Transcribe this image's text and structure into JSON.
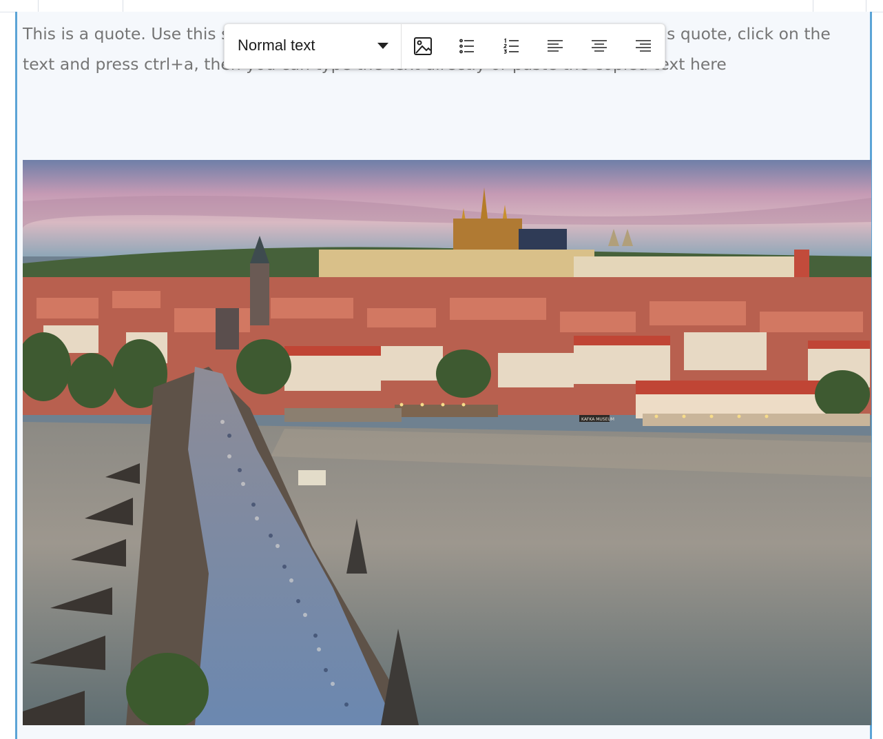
{
  "editor": {
    "quote_text": "This is a quote. Use this space to quote text from external resources. To edit this quote, click on the text and press ctrl+a, then you can type the text directly or paste the copied text here"
  },
  "toolbar": {
    "text_style": "Normal text",
    "buttons": [
      {
        "name": "insert-image",
        "icon": "image-icon"
      },
      {
        "name": "bulleted-list",
        "icon": "bulleted-list-icon"
      },
      {
        "name": "numbered-list",
        "icon": "numbered-list-icon"
      },
      {
        "name": "align-left",
        "icon": "align-left-icon"
      },
      {
        "name": "align-center",
        "icon": "align-center-icon"
      },
      {
        "name": "align-right",
        "icon": "align-right-icon"
      }
    ]
  },
  "image": {
    "sign_text": "KAFKA MUSEUM"
  },
  "colors": {
    "selection_border": "#5ba4d6",
    "block_background": "#f5f8fc",
    "quote_text": "#757575"
  }
}
